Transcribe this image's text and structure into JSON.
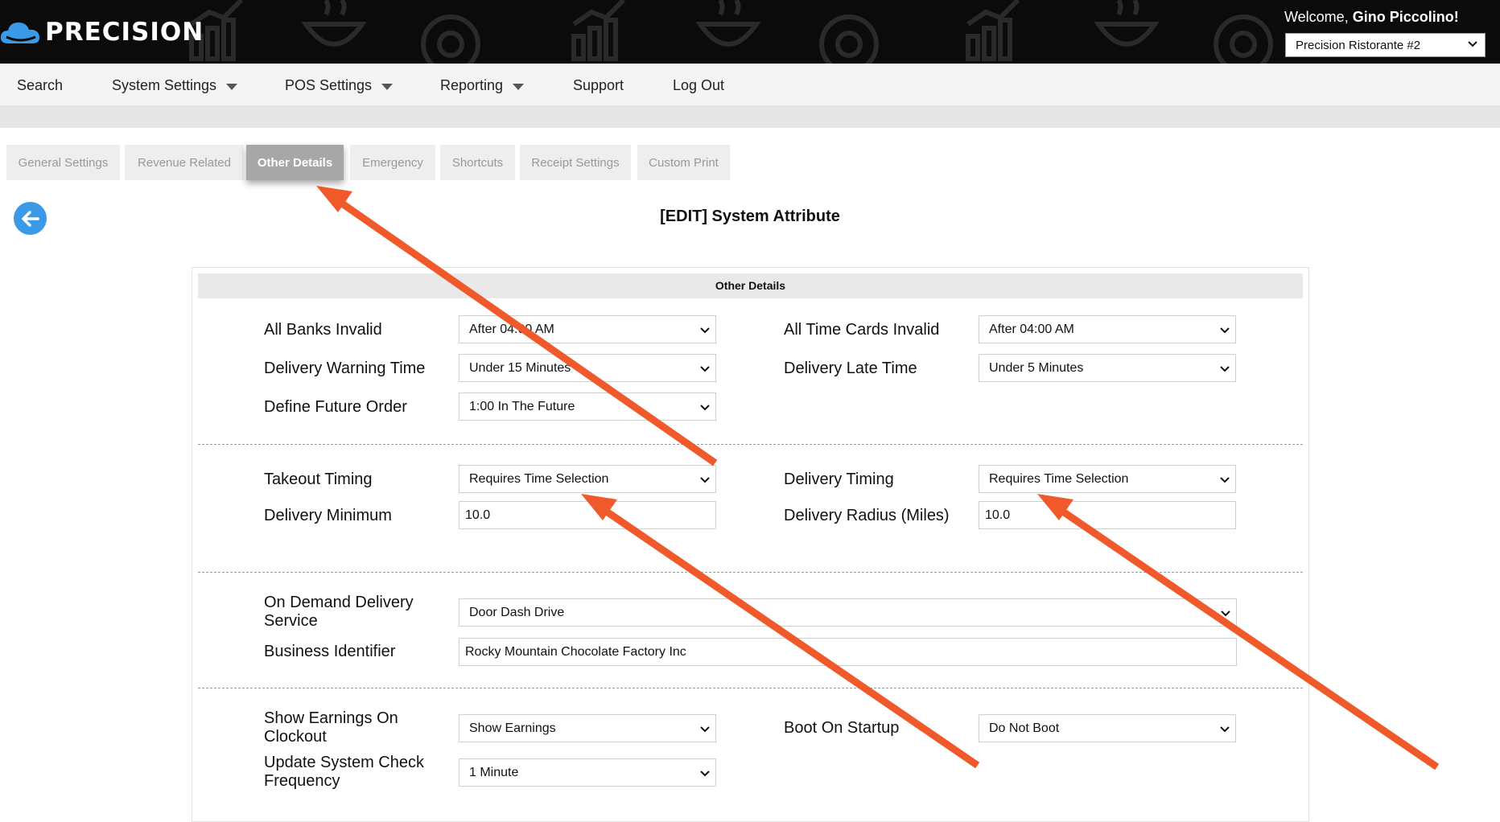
{
  "header": {
    "logo_text": "PRECISION",
    "welcome_prefix": "Welcome, ",
    "user_name": "Gino Piccolino!",
    "location_selected": "Precision Ristorante #2"
  },
  "nav": {
    "items": [
      {
        "label": "Search"
      },
      {
        "label": "System Settings"
      },
      {
        "label": "POS Settings"
      },
      {
        "label": "Reporting"
      },
      {
        "label": "Support"
      },
      {
        "label": "Log Out"
      }
    ]
  },
  "tabs": [
    {
      "label": "General Settings"
    },
    {
      "label": "Revenue Related"
    },
    {
      "label": "Other Details"
    },
    {
      "label": "Emergency"
    },
    {
      "label": "Shortcuts"
    },
    {
      "label": "Receipt Settings"
    },
    {
      "label": "Custom Print"
    }
  ],
  "page": {
    "title": "[EDIT] System Attribute",
    "panel_title": "Other Details"
  },
  "fields": {
    "all_banks_invalid": {
      "label": "All Banks Invalid",
      "value": "After 04:00 AM"
    },
    "all_time_cards_invalid": {
      "label": "All Time Cards Invalid",
      "value": "After 04:00 AM"
    },
    "delivery_warning_time": {
      "label": "Delivery Warning Time",
      "value": "Under 15 Minutes"
    },
    "delivery_late_time": {
      "label": "Delivery Late Time",
      "value": "Under 5 Minutes"
    },
    "define_future_order": {
      "label": "Define Future Order",
      "value": "1:00 In The Future"
    },
    "takeout_timing": {
      "label": "Takeout Timing",
      "value": "Requires Time Selection"
    },
    "delivery_timing": {
      "label": "Delivery Timing",
      "value": "Requires Time Selection"
    },
    "delivery_minimum": {
      "label": "Delivery Minimum",
      "value": "10.0"
    },
    "delivery_radius": {
      "label": "Delivery Radius (Miles)",
      "value": "10.0"
    },
    "on_demand_delivery": {
      "label_line1": "On Demand Delivery",
      "label_line2": "Service",
      "value": "Door Dash Drive"
    },
    "business_identifier": {
      "label": "Business Identifier",
      "value": "Rocky Mountain Chocolate Factory Inc"
    },
    "show_earnings": {
      "label_line1": "Show Earnings On",
      "label_line2": "Clockout",
      "value": "Show Earnings"
    },
    "boot_on_startup": {
      "label": "Boot On Startup",
      "value": "Do Not Boot"
    },
    "update_frequency": {
      "label_line1": "Update System Check",
      "label_line2": "Frequency",
      "value": "1 Minute"
    }
  },
  "colors": {
    "header_bg": "#0b0b0b",
    "accent_blue": "#3a9ae8",
    "annotation_arrow": "#f0592a",
    "active_tab": "#a7a7a7"
  }
}
